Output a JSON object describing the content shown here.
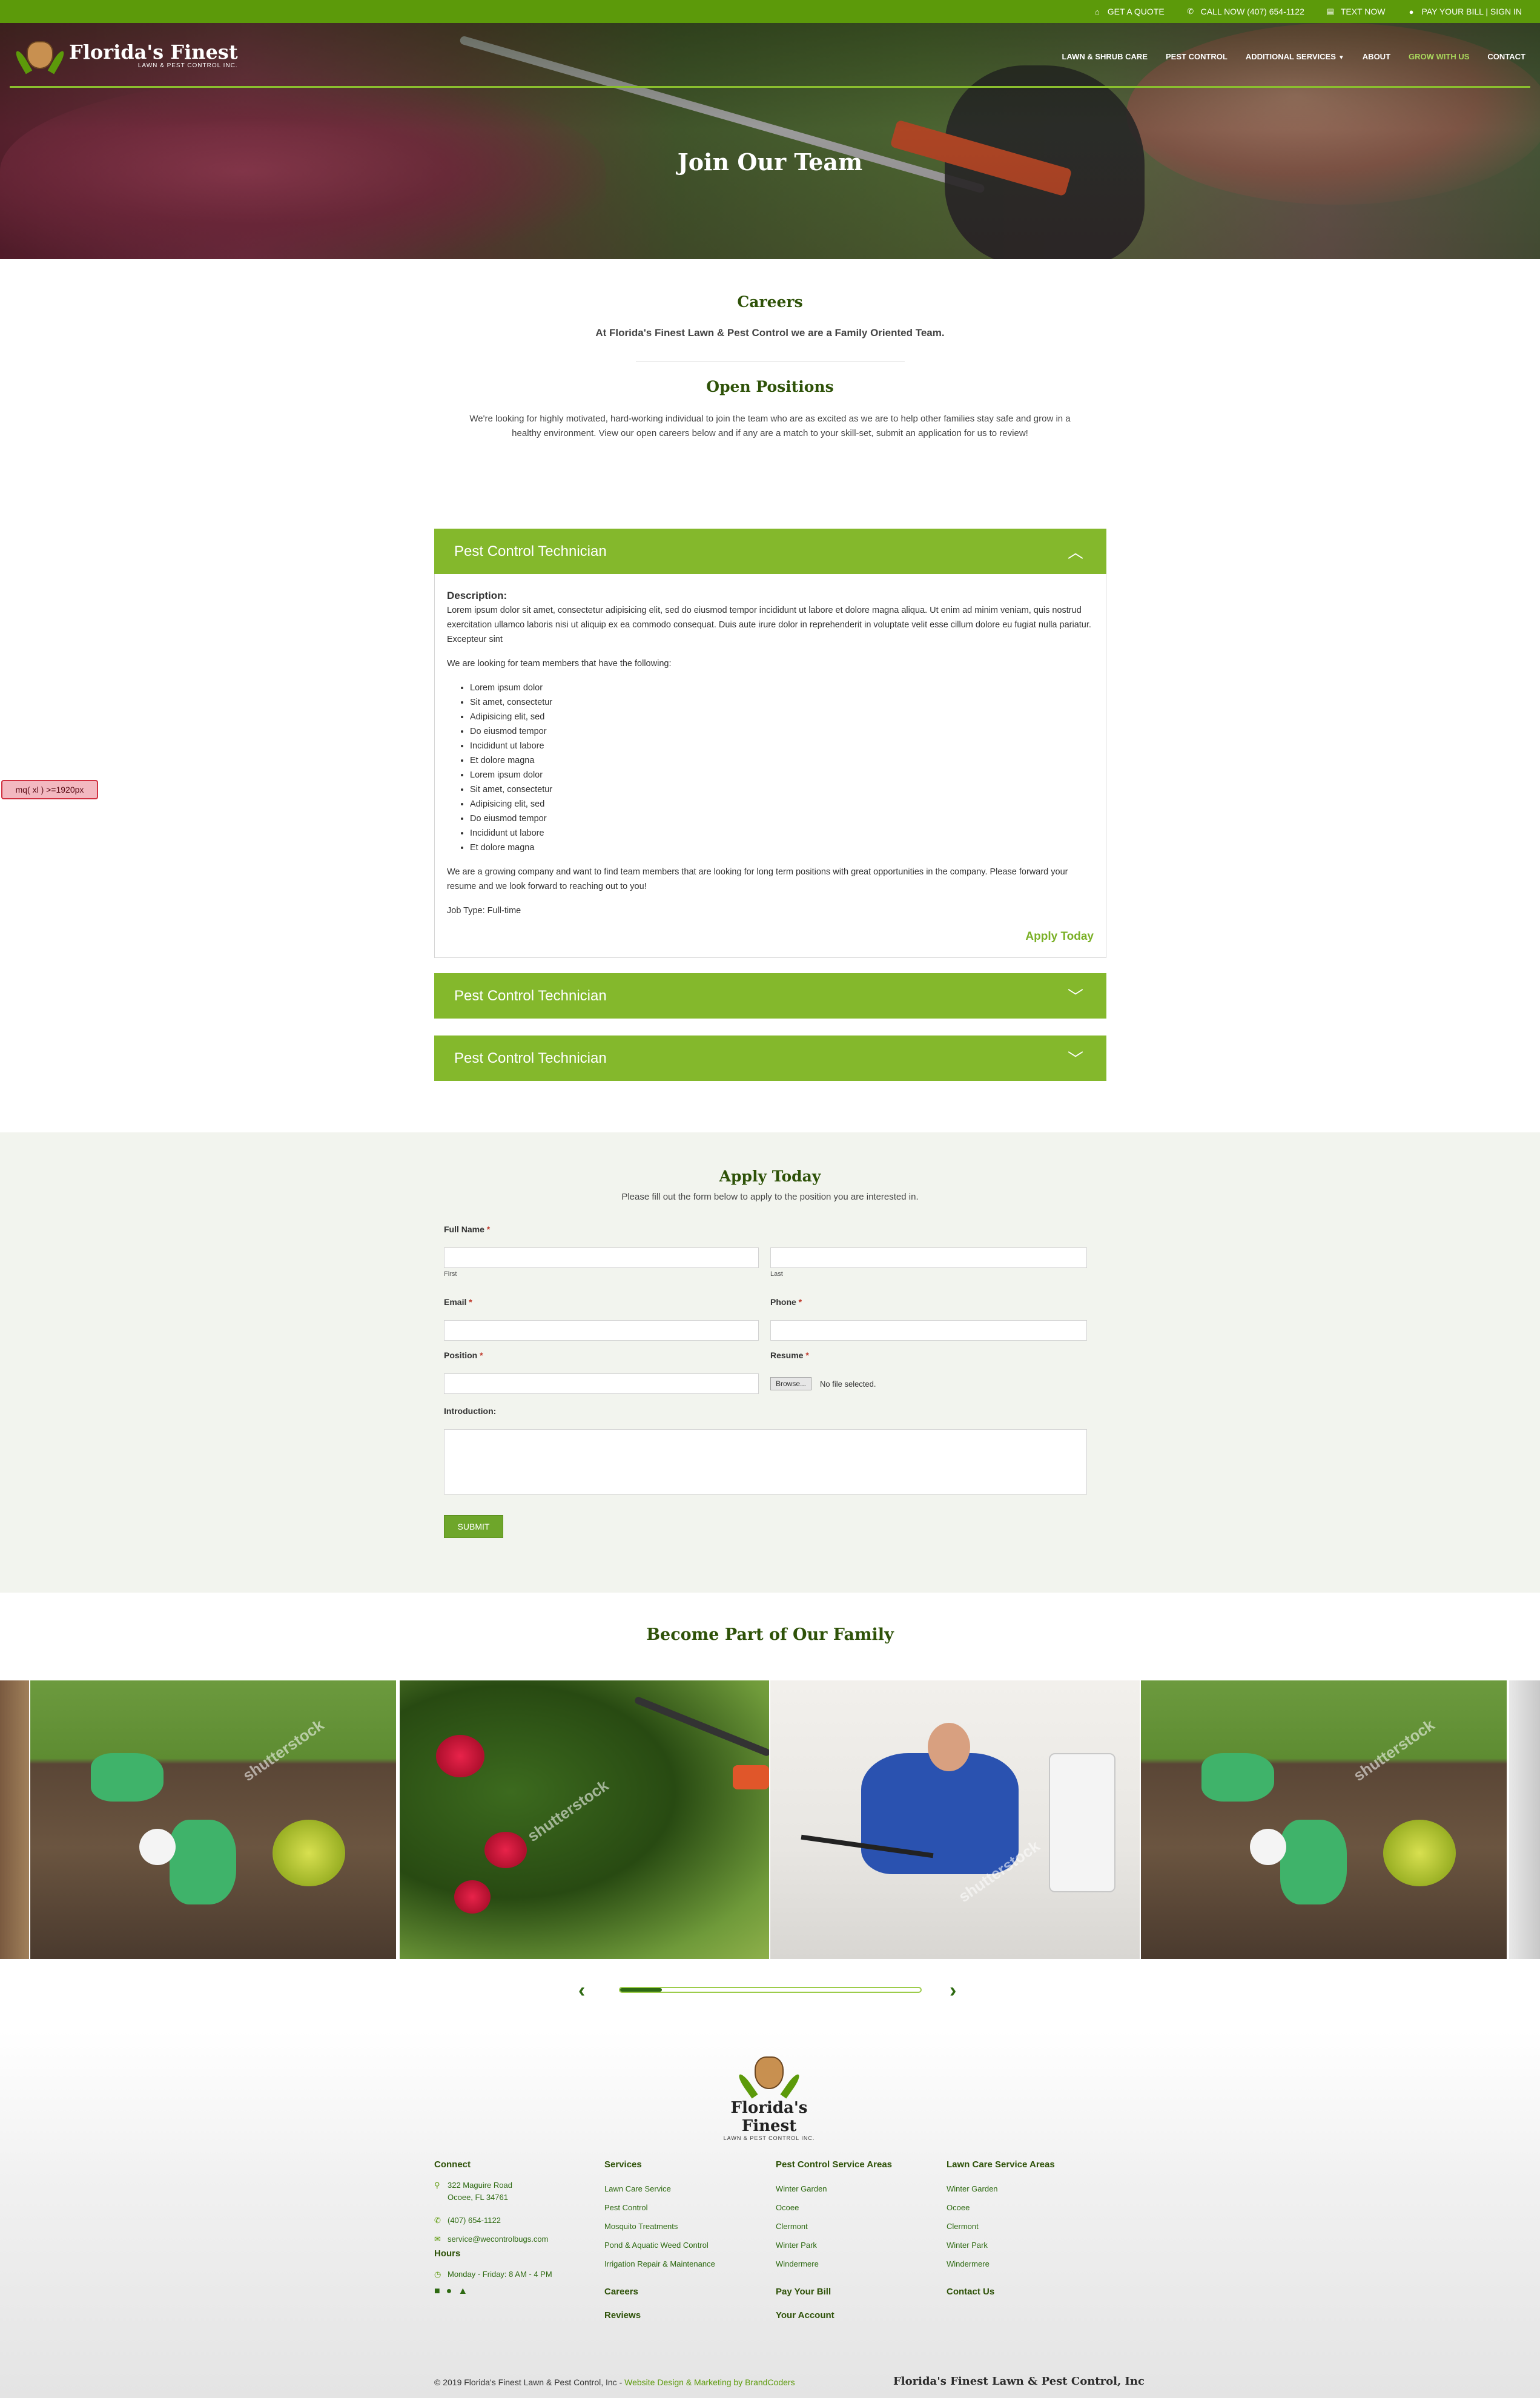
{
  "topbar": {
    "links": [
      {
        "icon": "home-icon",
        "label": "GET A QUOTE"
      },
      {
        "icon": "phone-icon",
        "label": "CALL NOW (407) 654-1122"
      },
      {
        "icon": "chat-icon",
        "label": "TEXT NOW"
      },
      {
        "icon": "dollar-icon",
        "label": "PAY YOUR BILL | SIGN IN"
      }
    ],
    "bg_color": "#5c9a0a"
  },
  "logo": {
    "name": "Florida's Finest",
    "sub": "LAWN & PEST CONTROL INC."
  },
  "nav": {
    "items": [
      "LAWN & SHRUB CARE",
      "PEST CONTROL",
      "ADDITIONAL SERVICES",
      "ABOUT",
      "GROW WITH US",
      "CONTACT"
    ],
    "active": "GROW WITH US"
  },
  "hero": {
    "title": "Join Our Team"
  },
  "careers": {
    "title": "Careers",
    "subtitle": "At Florida's Finest Lawn & Pest Control we are a Family Oriented Team."
  },
  "open_positions": {
    "title": "Open Positions",
    "body": "We're looking for highly motivated, hard-working individual to join the team who are as excited as we are to help other families stay safe and grow in a healthy environment. View our open careers below and if any are a match to your skill-set, submit an application for us to review!"
  },
  "positions": [
    {
      "title": "Pest Control Technician",
      "expanded": true
    },
    {
      "title": "Pest Control Technician",
      "expanded": false
    },
    {
      "title": "Pest Control Technician",
      "expanded": false
    }
  ],
  "position_detail": {
    "description_label": "Description:",
    "description": "Lorem ipsum dolor sit amet, consectetur adipisicing elit, sed do eiusmod tempor incididunt ut labore et dolore magna aliqua. Ut enim ad minim veniam, quis nostrud exercitation ullamco laboris nisi ut aliquip ex ea commodo consequat. Duis aute irure dolor in reprehenderit in voluptate velit esse cillum dolore eu fugiat nulla pariatur. Excepteur sint",
    "lookfor": "We are looking for team members that have the following:",
    "bullets": [
      "Lorem ipsum dolor",
      "Sit amet, consectetur",
      "Adipisicing elit, sed",
      "Do eiusmod tempor",
      "Incididunt ut labore",
      "Et dolore magna",
      "Lorem ipsum dolor",
      "Sit amet, consectetur",
      "Adipisicing elit, sed",
      "Do eiusmod tempor",
      "Incididunt ut labore",
      "Et dolore magna"
    ],
    "closing": "We are a growing company and want to find team members that are looking for long term positions with great opportunities in the company. Please forward your resume and we look forward to reaching out to you!",
    "job_type": "Job Type: Full-time",
    "apply": "Apply Today"
  },
  "debug_badge": "mq( xl ) >=1920px",
  "form": {
    "title": "Apply Today",
    "desc": "Please fill out the form below to apply to the position you are interested in.",
    "full_name": "Full Name",
    "first": "First",
    "last": "Last",
    "email": "Email",
    "phone": "Phone",
    "position": "Position",
    "resume": "Resume",
    "browse": "Browse...",
    "no_file": "No file selected.",
    "introduction": "Introduction:",
    "required": "*",
    "submit": "SUBMIT"
  },
  "gallery": {
    "title": "Become Part of Our Family",
    "watermark": "shutterstock",
    "prev": "‹",
    "next": "›",
    "progress": 0.14
  },
  "footer": {
    "logo_name": "Florida's Finest",
    "logo_sub": "LAWN & PEST CONTROL INC.",
    "connect": {
      "title": "Connect",
      "address1": "322 Maguire Road",
      "address2": "Ocoee, FL 34761",
      "phone": "(407) 654-1122",
      "email": "service@wecontrolbugs.com",
      "hours_title": "Hours",
      "hours": "Monday - Friday: 8 AM - 4 PM"
    },
    "services": {
      "title": "Services",
      "items": [
        "Lawn Care Service",
        "Pest Control",
        "Mosquito Treatments",
        "Pond & Aquatic Weed Control",
        "Irrigation Repair & Maintenance"
      ],
      "extra": [
        "Careers",
        "Reviews"
      ]
    },
    "pest_areas": {
      "title": "Pest Control Service Areas",
      "items": [
        "Winter Garden",
        "Ocoee",
        "Clermont",
        "Winter Park",
        "Windermere"
      ],
      "extra": [
        "Pay Your Bill",
        "Your Account"
      ]
    },
    "lawn_areas": {
      "title": "Lawn Care Service Areas",
      "items": [
        "Winter Garden",
        "Ocoee",
        "Clermont",
        "Winter Park",
        "Windermere"
      ],
      "extra": [
        "Contact Us"
      ]
    },
    "copyright": "© 2019 Florida's Finest Lawn & Pest Control, Inc -",
    "credit": "Website Design & Marketing by BrandCoders",
    "brand": "Florida's Finest Lawn & Pest Control, Inc"
  }
}
